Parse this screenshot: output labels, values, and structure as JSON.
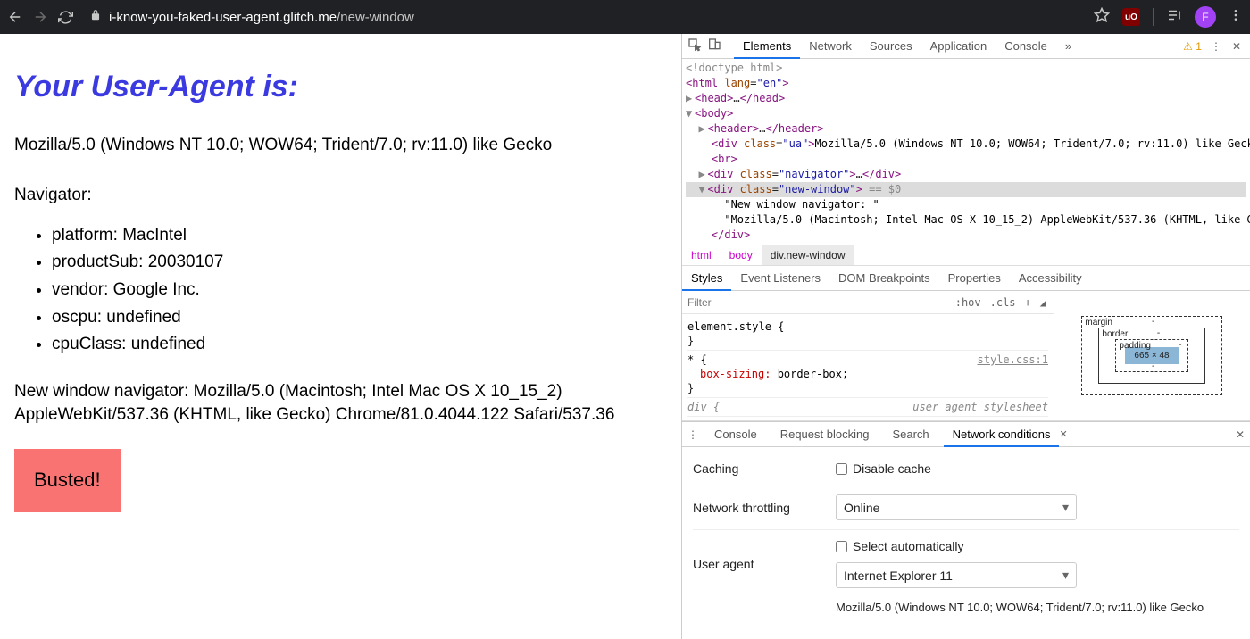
{
  "browser": {
    "url_host": "i-know-you-faked-user-agent.glitch.me",
    "url_path": "/new-window",
    "profile_letter": "F",
    "ublock_text": "uO"
  },
  "page": {
    "heading": "Your User-Agent is:",
    "ua_string": "Mozilla/5.0 (Windows NT 10.0; WOW64; Trident/7.0; rv:11.0) like Gecko",
    "navigator_label": "Navigator:",
    "items": {
      "platform": "platform: MacIntel",
      "productSub": "productSub: 20030107",
      "vendor": "vendor: Google Inc.",
      "oscpu": "oscpu: undefined",
      "cpuClass": "cpuClass: undefined"
    },
    "new_window_text": "New window navigator: Mozilla/5.0 (Macintosh; Intel Mac OS X 10_15_2) AppleWebKit/537.36 (KHTML, like Gecko) Chrome/81.0.4044.122 Safari/537.36",
    "busted": "Busted!"
  },
  "devtools": {
    "tabs": {
      "elements": "Elements",
      "network": "Network",
      "sources": "Sources",
      "application": "Application",
      "console": "Console",
      "more": "»"
    },
    "warnings": "1",
    "dom": {
      "doctype": "<!doctype html>",
      "html_open": "<html lang=\"en\">",
      "head": "<head>…</head>",
      "body_open": "<body>",
      "header": "<header>…</header>",
      "ua_div": "<div class=\"ua\">Mozilla/5.0 (Windows NT 10.0; WOW64; Trident/7.0; rv:11.0) like Geck",
      "br": "<br>",
      "nav_div": "<div class=\"navigator\">…</div>",
      "newwin_open": "<div class=\"new-window\"> == $0",
      "newwin_t1": "\"New window navigator: \"",
      "newwin_t2": "\"Mozilla/5.0 (Macintosh; Intel Mac OS X 10_15_2) AppleWebKit/537.36 (KHTML, like G",
      "newwin_close": "</div>"
    },
    "breadcrumb": {
      "html": "html",
      "body": "body",
      "div": "div.new-window"
    },
    "styles_tabs": {
      "styles": "Styles",
      "event": "Event Listeners",
      "dom_bp": "DOM Breakpoints",
      "props": "Properties",
      "access": "Accessibility"
    },
    "filter_placeholder": "Filter",
    "filter_extras": {
      "hov": ":hov",
      "cls": ".cls",
      "plus": "+"
    },
    "rules": {
      "element_style": "element.style {",
      "element_style_close": "}",
      "star": "* {",
      "box_sizing": "box-sizing:",
      "box_sizing_val": " border-box;",
      "star_close": "}",
      "star_link": "style.css:1",
      "div_sel": "div {",
      "ua_sheet": "user agent stylesheet"
    },
    "box_model": {
      "margin": "margin",
      "border": "border",
      "padding": "padding",
      "content": "665 × 48",
      "dash": "-"
    },
    "drawer": {
      "tabs": {
        "console": "Console",
        "request": "Request blocking",
        "search": "Search",
        "netcond": "Network conditions"
      },
      "caching_label": "Caching",
      "disable_cache": "Disable cache",
      "throttling_label": "Network throttling",
      "throttling_value": "Online",
      "ua_label": "User agent",
      "select_auto": "Select automatically",
      "ua_preset": "Internet Explorer 11",
      "ua_full": "Mozilla/5.0 (Windows NT 10.0; WOW64; Trident/7.0; rv:11.0) like Gecko"
    }
  }
}
